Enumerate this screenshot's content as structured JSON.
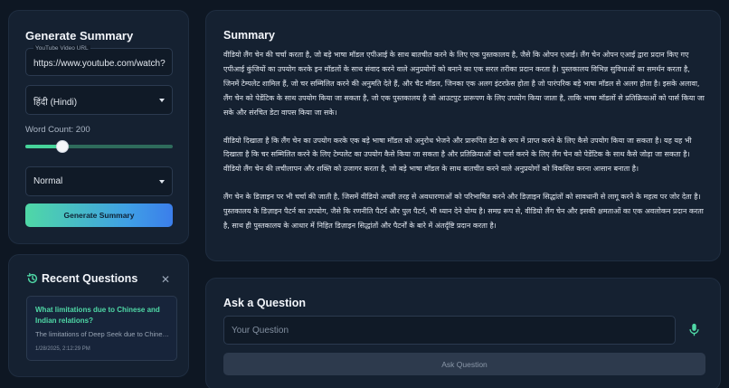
{
  "generate": {
    "title": "Generate Summary",
    "url_label": "YouTube Video URL",
    "url_value": "https://www.youtube.com/watch?",
    "language": "हिंदी (Hindi)",
    "word_count_label": "Word Count: 200",
    "word_count_level": 0.25,
    "style": "Normal",
    "button_label": "Generate Summary"
  },
  "recent": {
    "title": "Recent Questions",
    "items": [
      {
        "question": "What limitations due to Chinese and Indian relations?",
        "snippet": "The limitations of Deep Seek due to Chinese and Indian relations",
        "date": "1/28/2025, 2:12:29 PM"
      }
    ]
  },
  "summary": {
    "title": "Summary",
    "paragraphs": [
      "वीडियो लैंग चेन की चर्चा करता है, जो बड़े भाषा मॉडल एपीआई के साथ बातचीत करने के लिए एक पुस्तकालय है, जैसे कि ओपन एआई। लैंग चेन ओपन एआई द्वारा प्रदान किए गए एपीआई कुंजियों का उपयोग करके इन मॉडलों के साथ संवाद करने वाले अनुप्रयोगों को बनाने का एक सरल तरीका प्रदान करता है। पुस्तकालय विभिन्न सुविधाओं का समर्थन करता है, जिनमें टेम्पलेट शामिल हैं, जो चर सम्मिलित करने की अनुमति देते हैं, और चैट मॉडल, जिनका एक अलग इंटरफ़ेस होता है जो पारंपरिक बड़े भाषा मॉडल से अलग होता है। इसके अलावा, लैंग चेन को पेडेंटिक के साथ उपयोग किया जा सकता है, जो एक पुस्तकालय है जो आउटपुट प्रारूपण के लिए उपयोग किया जाता है, ताकि भाषा मॉडलों से प्रतिक्रियाओं को पार्स किया जा सके और संरचित डेटा वापस किया जा सके।",
      "वीडियो दिखाता है कि लैंग चेन का उपयोग करके एक बड़े भाषा मॉडल को अनुरोध भेजने और प्रारूपित डेटा के रूप में प्राप्त करने के लिए कैसे उपयोग किया जा सकता है। यह यह भी दिखाता है कि चर सम्मिलित करने के लिए टेम्पलेट का उपयोग कैसे किया जा सकता है और प्रतिक्रियाओं को पार्स करने के लिए लैंग चेन को पेडेंटिक के साथ कैसे जोड़ा जा सकता है। वीडियो लैंग चेन की लचीलापन और शक्ति को उजागर करता है, जो बड़े भाषा मॉडल के साथ बातचीत करने वाले अनुप्रयोगों को विकसित करना आसान बनाता है।",
      "लैंग चेन के डिज़ाइन पर भी चर्चा की जाती है, जिसमें वीडियो अच्छी तरह से अवधारणाओं को परिभाषित करने और डिज़ाइन सिद्धांतों को सावधानी से लागू करने के महत्व पर जोर देता है। पुस्तकालय के डिज़ाइन पैटर्न का उपयोग, जैसे कि रणनीति पैटर्न और पुल पैटर्न, भी ध्यान देने योग्य है। समग्र रूप से, वीडियो लैंग चेन और इसकी क्षमताओं का एक अवलोकन प्रदान करता है, साथ ही पुस्तकालय के आधार में निहित डिज़ाइन सिद्धांतों और पैटर्नों के बारे में अंतर्दृष्टि प्रदान करता है।"
    ]
  },
  "ask": {
    "title": "Ask a Question",
    "placeholder": "Your Question",
    "button_label": "Ask Question"
  },
  "colors": {
    "accent_green": "#4fd8a6",
    "accent_blue": "#3b7eea",
    "panel": "#152131",
    "background": "#0e1723"
  },
  "icons": [
    "history-icon",
    "close-icon",
    "chevron-down-icon",
    "microphone-icon"
  ]
}
